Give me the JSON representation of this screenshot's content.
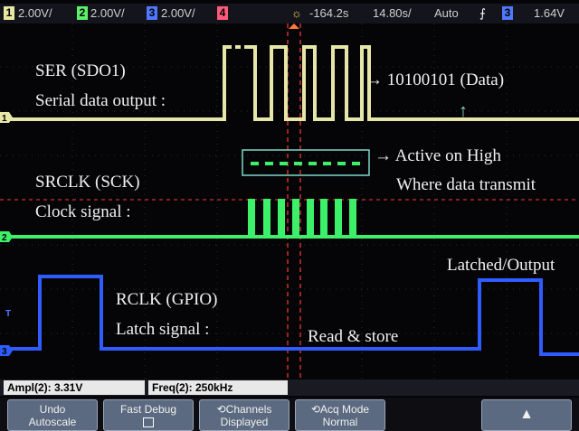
{
  "status_bar": {
    "ch1": {
      "num": "1",
      "scale": "2.00V/",
      "color": "#e8e8a0"
    },
    "ch2": {
      "num": "2",
      "scale": "2.00V/",
      "color": "#5cf06a"
    },
    "ch3": {
      "num": "3",
      "scale": "2.00V/",
      "color": "#5078ff"
    },
    "ch4": {
      "num": "4",
      "color": "#ff5a7a"
    },
    "delay": "-164.2s",
    "timebase": "14.80s/",
    "trigger_mode": "Auto",
    "trigger_channel": "3",
    "trigger_level": "1.64V"
  },
  "annotations": {
    "ser_title": "SER (SDO1)",
    "ser_desc": "Serial data output :",
    "data_arrow": "→ 10100101 (Data)",
    "active_high": "→ Active on High",
    "where_data": "Where data transmit",
    "srclk_title": "SRCLK (SCK)",
    "clock_desc": "Clock signal :",
    "latched_output": "Latched/Output",
    "rclk_title": "RCLK (GPIO)",
    "latch_desc": "Latch signal :",
    "read_store": "Read & store",
    "up_arrow": "↑"
  },
  "channel_markers": {
    "ch1": "1",
    "ch2": "2",
    "ch3": "3",
    "trig": "T"
  },
  "measurements": {
    "ampl": "Ampl(2): 3.31V",
    "freq": "Freq(2): 250kHz"
  },
  "softkeys": {
    "undo_autoscale": [
      "Undo",
      "Autoscale"
    ],
    "fast_debug": "Fast Debug",
    "channels_displayed": [
      "Channels",
      "Displayed"
    ],
    "acq_mode": [
      "Acq Mode",
      "Normal"
    ],
    "up_arrow": "▲"
  },
  "colors": {
    "ser_trace": "#e6e6a8",
    "clk_trace": "#3cf06a",
    "rclk_trace": "#2f5cff",
    "cursor": "#ff3a3a",
    "box": "#7fd8c8"
  }
}
